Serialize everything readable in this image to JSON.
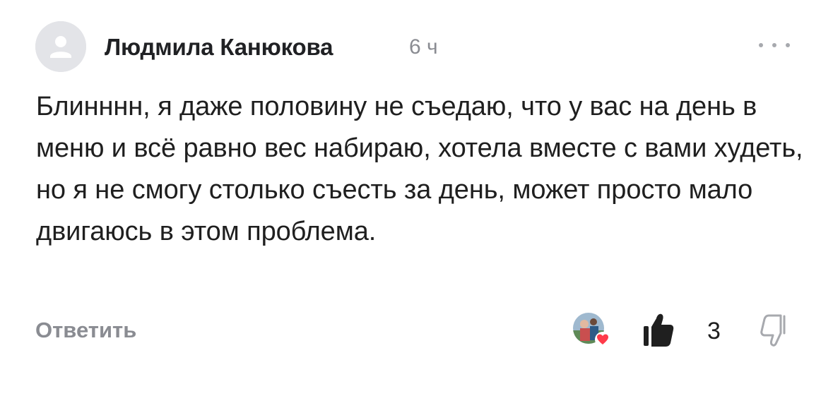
{
  "comment": {
    "author": "Людмила Канюкова",
    "time": "6 ч",
    "text": "Блинннн, я даже половину не съедаю, что у вас на день в меню и всё равно вес набираю, хотела вместе с вами худеть, но я не смогу столько съесть за день, может просто мало двигаюсь в этом проблема.",
    "reply_label": "Ответить",
    "like_count": "3",
    "icons": {
      "avatar": "user-placeholder-icon",
      "more": "more-dots-icon",
      "liker": "liker-avatar-with-heart-icon",
      "like": "thumbs-up-icon",
      "dislike": "thumbs-down-icon"
    }
  },
  "colors": {
    "text": "#1f1f1f",
    "muted": "#8a8c92",
    "avatar_bg": "#e3e4e8",
    "heart": "#ff3b4a"
  }
}
